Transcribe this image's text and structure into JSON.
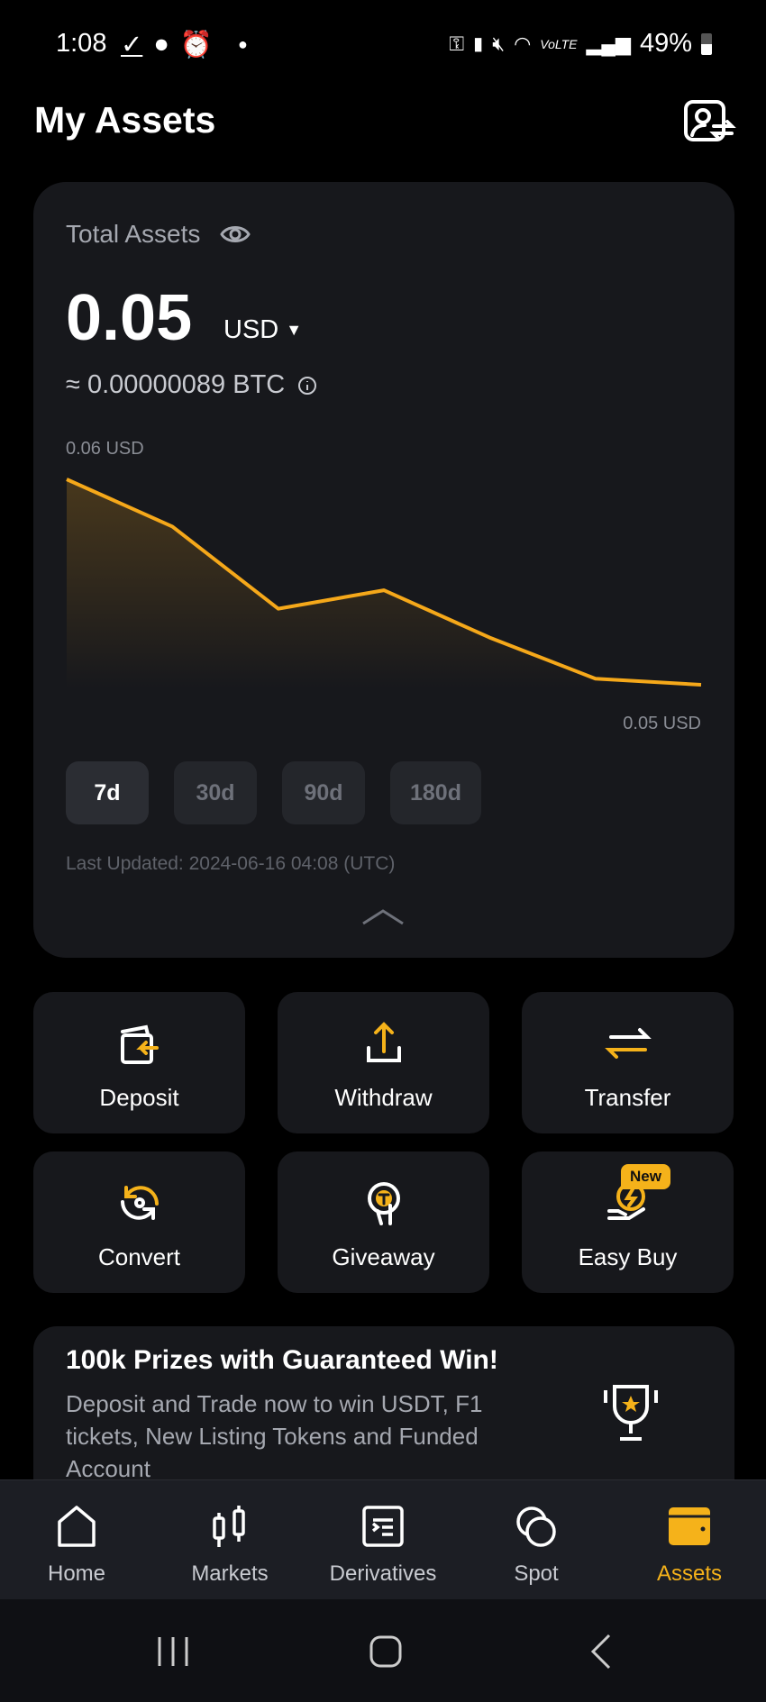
{
  "status_bar": {
    "time": "1:08",
    "battery": "49%",
    "icons": [
      "check-icon",
      "cloud-icon",
      "alarm-icon",
      "dot-icon",
      "key-icon",
      "battery-saver-icon",
      "mute-icon",
      "wifi-icon",
      "volte-icon",
      "signal-icon",
      "battery-icon"
    ]
  },
  "header": {
    "title": "My Assets",
    "action_icon": "account-switch-icon"
  },
  "summary": {
    "label": "Total Assets",
    "amount": "0.05",
    "currency": "USD",
    "btc_equiv": "≈ 0.00000089 BTC",
    "chart_max_label": "0.06 USD",
    "chart_min_label": "0.05 USD",
    "periods": [
      "7d",
      "30d",
      "90d",
      "180d"
    ],
    "selected_period": "7d",
    "last_updated": "Last Updated: 2024-06-16 04:08 (UTC)"
  },
  "chart_data": {
    "type": "area",
    "values": [
      0.06,
      0.0577,
      0.0537,
      0.0546,
      0.0523,
      0.0503,
      0.05
    ],
    "ylim": [
      0.05,
      0.06
    ],
    "color": "#f5a81a",
    "grid": false
  },
  "actions": [
    {
      "label": "Deposit",
      "icon": "deposit-icon"
    },
    {
      "label": "Withdraw",
      "icon": "withdraw-icon"
    },
    {
      "label": "Transfer",
      "icon": "transfer-icon"
    },
    {
      "label": "Convert",
      "icon": "convert-icon"
    },
    {
      "label": "Giveaway",
      "icon": "giveaway-icon"
    },
    {
      "label": "Easy Buy",
      "icon": "easy-buy-icon",
      "badge": "New"
    }
  ],
  "promo": {
    "title": "100k Prizes with Guaranteed Win!",
    "text": "Deposit and Trade now to win USDT, F1 tickets, New Listing Tokens and Funded Account",
    "icon": "trophy-icon"
  },
  "nav": [
    {
      "label": "Home",
      "icon": "home-icon"
    },
    {
      "label": "Markets",
      "icon": "candlestick-icon"
    },
    {
      "label": "Derivatives",
      "icon": "derivatives-icon"
    },
    {
      "label": "Spot",
      "icon": "spot-icon"
    },
    {
      "label": "Assets",
      "icon": "wallet-icon",
      "active": true
    }
  ],
  "colors": {
    "accent": "#f5b21a",
    "card": "#17181c",
    "background": "#000000"
  }
}
